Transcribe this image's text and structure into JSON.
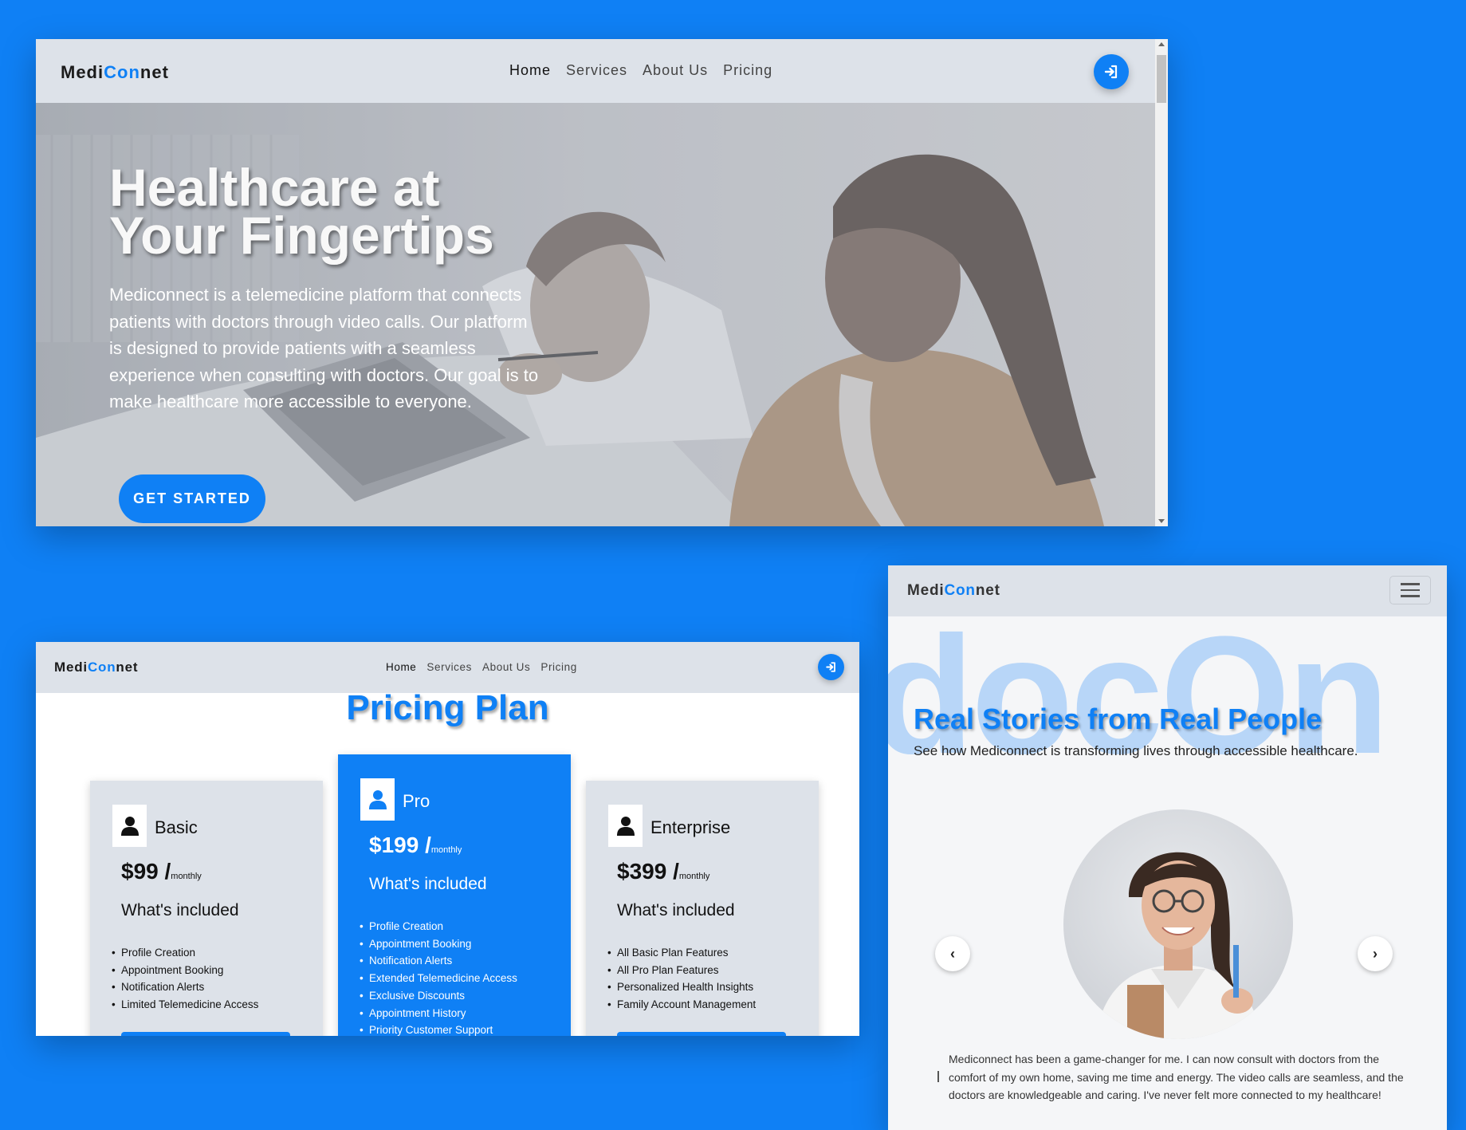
{
  "brand": {
    "part1": "Medi",
    "part2": "Con",
    "part3": "net"
  },
  "nav": {
    "home": "Home",
    "services": "Services",
    "about": "About Us",
    "pricing": "Pricing"
  },
  "hero": {
    "title_line1": "Healthcare at",
    "title_line2": "Your Fingertips",
    "text": "Mediconnect is a telemedicine platform that connects patients with doctors through video calls. Our platform is designed to provide patients with a seamless experience when consulting with doctors. Our goal is to make healthcare more accessible to everyone.",
    "cta": "GET STARTED"
  },
  "pricing": {
    "title": "Pricing Plan",
    "plans": [
      {
        "name": "Basic",
        "price": "$99 /",
        "period": "monthly",
        "included": "What's included",
        "features": [
          "Profile Creation",
          "Appointment Booking",
          "Notification Alerts",
          "Limited Telemedicine Access"
        ]
      },
      {
        "name": "Pro",
        "price": "$199 /",
        "period": "monthly",
        "included": "What's included",
        "features": [
          "Profile Creation",
          "Appointment Booking",
          "Notification Alerts",
          "Extended Telemedicine Access",
          "Exclusive Discounts",
          "Appointment History",
          "Priority Customer Support"
        ]
      },
      {
        "name": "Enterprise",
        "price": "$399 /",
        "period": "monthly",
        "included": "What's included",
        "features": [
          "All Basic Plan Features",
          "All Pro Plan Features",
          "Personalized Health Insights",
          "Family Account Management"
        ]
      }
    ]
  },
  "testimonials": {
    "bg_text": "docOn",
    "title": "Real Stories from Real People",
    "subtitle": "See how Mediconnect is transforming lives through accessible healthcare.",
    "prev": "‹",
    "next": "›",
    "quote": "Mediconnect has been a game-changer for me. I can now consult with doctors from the comfort of my own home, saving me time and energy. The video calls are seamless, and the doctors are knowledgeable and caring. I've never felt more connected to my healthcare!"
  },
  "colors": {
    "accent": "#0f80f5",
    "nav_bg": "#dde2e9",
    "card_bg": "#dde2e9"
  },
  "icons": {
    "login": "sign-in-icon",
    "user": "user-icon",
    "menu": "hamburger-icon"
  }
}
